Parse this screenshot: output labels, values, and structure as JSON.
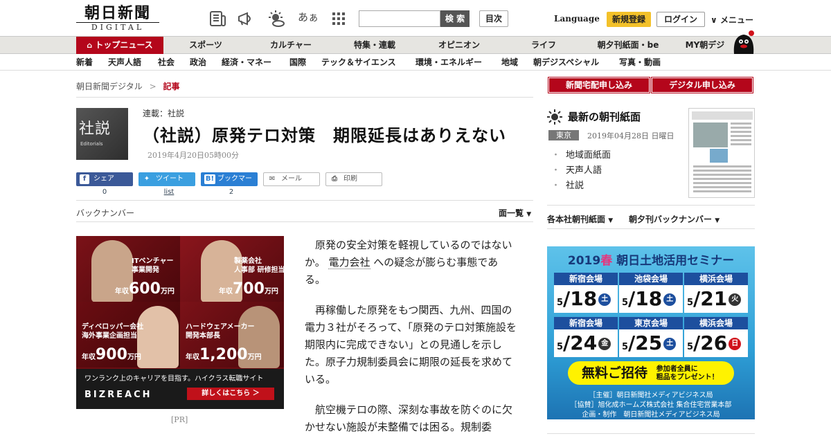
{
  "header": {
    "logo_jp": "朝日新聞",
    "logo_en": "DIGITAL",
    "search_placeholder": "",
    "search_label": "検 索",
    "toc_label": "目次",
    "language_label": "Language",
    "register_label": "新規登録",
    "login_label": "ログイン",
    "menu_label": "メニュー",
    "font_size_label": "あぁ",
    "icons": [
      "newspaper-icon",
      "megaphone-icon",
      "weather-icon",
      "font-size-icon",
      "grid-menu-icon"
    ]
  },
  "nav_primary": [
    "トップニュース",
    "スポーツ",
    "カルチャー",
    "特集・連載",
    "オピニオン",
    "ライフ",
    "朝夕刊紙面・be",
    "MY朝デジ"
  ],
  "nav_secondary": [
    "新着",
    "天声人語",
    "社会",
    "政治",
    "経済・マネー",
    "国際",
    "テック＆サイエンス",
    "環境・エネルギー",
    "地域",
    "朝デジスペシャル",
    "写真・動画"
  ],
  "breadcrumb": {
    "home": "朝日新聞デジタル",
    "separator": ">",
    "current": "記事"
  },
  "article": {
    "thumb_big": "社説",
    "thumb_small": "Editorials",
    "series": "連載：社説",
    "title": "（社説）原発テロ対策　期限延長はありえない",
    "date": "2019年4月20日05時00分",
    "share": [
      {
        "label": "シェア",
        "count": "0",
        "color": "#3b5998"
      },
      {
        "label": "ツイート",
        "count": "list",
        "color": "#3a9fe0"
      },
      {
        "label": "ブックマーク",
        "count": "2",
        "color": "#2a7fd4"
      },
      {
        "label": "メール",
        "count": ""
      },
      {
        "label": "印刷",
        "count": ""
      }
    ],
    "backnumber_label": "バックナンバー",
    "menlist_label": "面一覧",
    "paragraphs": [
      {
        "pre": "原発の安全対策を軽視しているのではないか。",
        "link": "電力会社",
        "post": "への疑念が膨らむ事態である。"
      },
      {
        "pre": "再稼働した原発をもつ関西、九州、四国の電力３社がそろって、「原発のテロ対策施設を期限内に完成できない」との見通しを示した。原子力規制委員会に期限の延長を求めている。",
        "link": "",
        "post": ""
      },
      {
        "pre": "航空機テロの際、深刻な事故を防ぐのに欠かせない施設が未整備では困る。規制委",
        "link": "",
        "post": ""
      }
    ]
  },
  "ad_left": {
    "quadrants": [
      {
        "role": "ITベンチャー\n事業開発",
        "prefix": "年収",
        "amount": "600",
        "unit": "万円"
      },
      {
        "role": "製薬会社\n人事部 研修担当",
        "prefix": "年収",
        "amount": "700",
        "unit": "万円"
      },
      {
        "role": "ディベロッパー会社\n海外事業企画担当",
        "prefix": "年収",
        "amount": "900",
        "unit": "万円"
      },
      {
        "role": "ハードウェアメーカー\n開発本部長",
        "prefix": "年収",
        "amount": "1,200",
        "unit": "万円"
      }
    ],
    "tagline": "ワンランク上のキャリアを目指す。ハイクラス転職サイト",
    "brand": "BIZREACH",
    "cta": "詳しくはこちら ＞",
    "pr_label": "[PR]"
  },
  "sidebar": {
    "subscribe_paper": "新聞宅配申し込み",
    "subscribe_digital": "デジタル申し込み",
    "latest_title": "最新の朝刊紙面",
    "edition": "東京",
    "paper_date": "2019年04月28日 日曜日",
    "links": [
      "地域面紙面",
      "天声人語",
      "社説"
    ],
    "dropdown_honsha": "各本社朝刊紙面",
    "dropdown_yukan": "朝夕刊バックナンバー"
  },
  "ad_right": {
    "year": "2019",
    "season": "春",
    "title": "朝日土地活用セミナー",
    "venues": [
      {
        "name": "新宿会場",
        "month": "5",
        "day": "18",
        "dow": "土",
        "dow_color": "#1d4f9e"
      },
      {
        "name": "池袋会場",
        "month": "5",
        "day": "18",
        "dow": "土",
        "dow_color": "#1d4f9e"
      },
      {
        "name": "横浜会場",
        "month": "5",
        "day": "21",
        "dow": "火",
        "dow_color": "#333333"
      },
      {
        "name": "新宿会場",
        "month": "5",
        "day": "24",
        "dow": "金",
        "dow_color": "#333333"
      },
      {
        "name": "東京会場",
        "month": "5",
        "day": "25",
        "dow": "土",
        "dow_color": "#1d4f9e"
      },
      {
        "name": "横浜会場",
        "month": "5",
        "day": "26",
        "dow": "日",
        "dow_color": "#d0121b"
      }
    ],
    "free_label": "無料ご招待",
    "gift_line1": "参加者全員に",
    "gift_line2": "粗品をプレゼント！",
    "org1": "［主催］朝日新聞社メディアビジネス局",
    "org2": "［協賛］旭化成ホームズ株式会社 集合住宅営業本部",
    "org3": "企画・制作　朝日新聞社メディアビジネス局"
  },
  "colors": {
    "brand_red": "#b4061b",
    "register_yellow": "#f3c12a",
    "nav_bg": "#e6e5e1"
  }
}
